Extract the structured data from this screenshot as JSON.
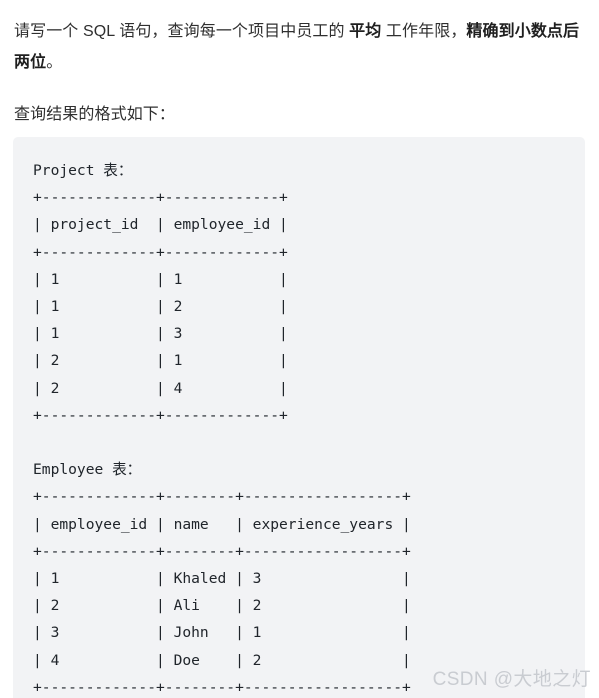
{
  "document": {
    "paragraph_1": {
      "segments": [
        {
          "text": "请写一个 SQL 语句，查询每一个项目中员工的 ",
          "bold": false
        },
        {
          "text": "平均",
          "bold": true
        },
        {
          "text": " 工作年限，",
          "bold": false
        },
        {
          "text": "精确到小数点后两位",
          "bold": true
        },
        {
          "text": "。",
          "bold": false
        }
      ],
      "plain": "请写一个 SQL 语句，查询每一个项目中员工的 平均 工作年限，精确到小数点后两位。"
    },
    "paragraph_2": {
      "text": "查询结果的格式如下："
    }
  },
  "code_block": {
    "background_color": "#f2f3f5",
    "text_color": "#20252b",
    "content": "Project 表：\n+-------------+-------------+\n| project_id  | employee_id |\n+-------------+-------------+\n| 1           | 1           |\n| 1           | 2           |\n| 1           | 3           |\n| 2           | 1           |\n| 2           | 4           |\n+-------------+-------------+\n\nEmployee 表：\n+-------------+--------+------------------+\n| employee_id | name   | experience_years |\n+-------------+--------+------------------+\n| 1           | Khaled | 3                |\n| 2           | Ali    | 2                |\n| 3           | John   | 1                |\n| 4           | Doe    | 2                |\n+-------------+--------+------------------+"
  },
  "tables": {
    "project": {
      "caption": "Project 表：",
      "columns": [
        "project_id",
        "employee_id"
      ],
      "rows": [
        [
          "1",
          "1"
        ],
        [
          "1",
          "2"
        ],
        [
          "1",
          "3"
        ],
        [
          "2",
          "1"
        ],
        [
          "2",
          "4"
        ]
      ]
    },
    "employee": {
      "caption": "Employee 表：",
      "columns": [
        "employee_id",
        "name",
        "experience_years"
      ],
      "rows": [
        [
          "1",
          "Khaled",
          "3"
        ],
        [
          "2",
          "Ali",
          "2"
        ],
        [
          "3",
          "John",
          "1"
        ],
        [
          "4",
          "Doe",
          "2"
        ]
      ]
    }
  },
  "watermark": {
    "text": "CSDN @大地之灯",
    "color": "#c9ccd1"
  }
}
